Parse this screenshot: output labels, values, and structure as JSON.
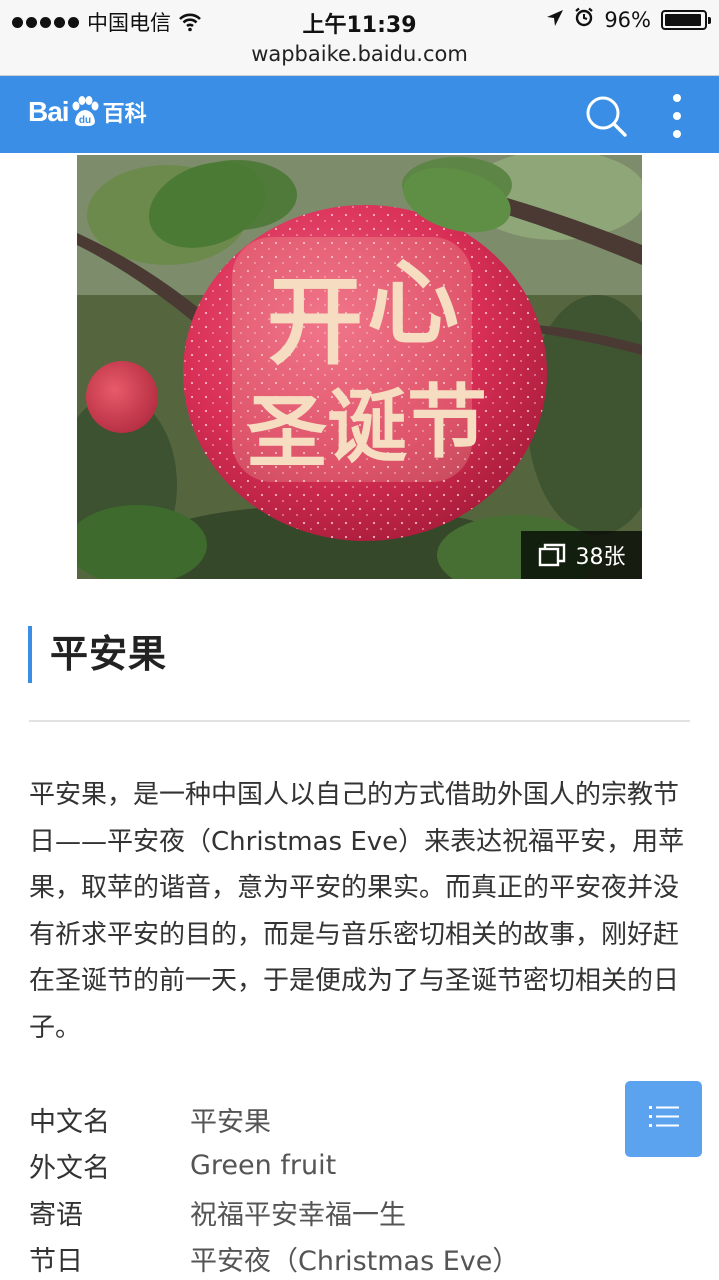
{
  "status_bar": {
    "carrier": "中国电信",
    "time": "上午11:39",
    "battery_percent_text": "96%",
    "battery_level": 0.96
  },
  "url": "wapbaike.baidu.com",
  "header": {
    "logo_text_bai": "Bai",
    "logo_text_du": "du",
    "logo_text_baike": "百科",
    "search_icon": "search-icon",
    "more_icon": "more-vertical-icon"
  },
  "hero": {
    "photo_count": "38张",
    "carving_text": "开心圣诞节"
  },
  "article": {
    "title": "平安果",
    "summary": "平安果，是一种中国人以自己的方式借助外国人的宗教节日——平安夜（Christmas Eve）来表达祝福平安，用苹果，取苹的谐音，意为平安的果实。而真正的平安夜并没有祈求平安的目的，而是与音乐密切相关的故事，刚好赶在圣诞节的前一天，于是便成为了与圣诞节密切相关的日子。"
  },
  "info": [
    {
      "key": "中文名",
      "value": "平安果"
    },
    {
      "key": "外文名",
      "value": "Green fruit"
    },
    {
      "key": "寄语",
      "value": "祝福平安幸福一生"
    },
    {
      "key": "节日",
      "value": "平安夜（Christmas Eve）"
    }
  ],
  "colors": {
    "brand_blue": "#3a8ee6",
    "toc_blue": "#5ba3ef"
  }
}
